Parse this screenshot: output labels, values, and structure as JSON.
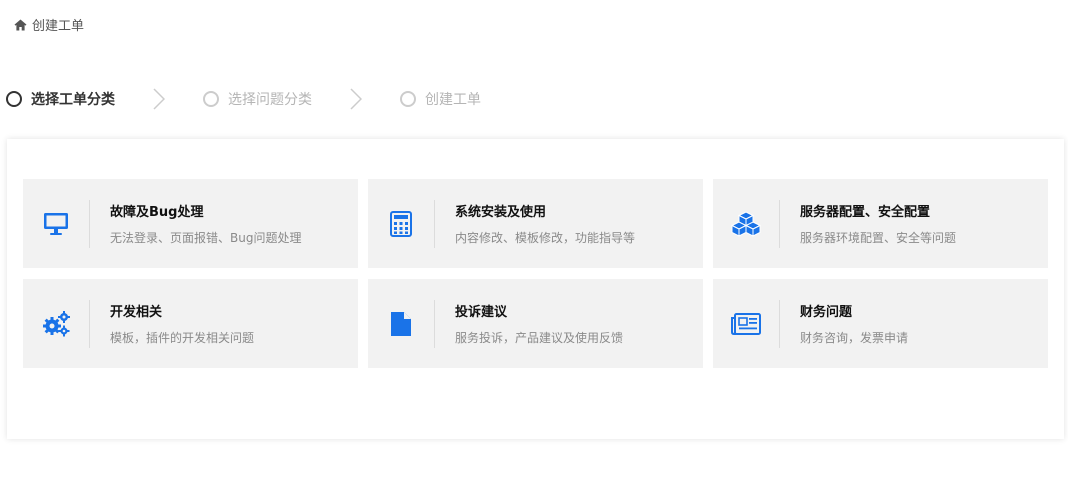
{
  "breadcrumb": {
    "icon": "home-icon",
    "label": "创建工单"
  },
  "steps": [
    {
      "label": "选择工单分类",
      "state": "active"
    },
    {
      "label": "选择问题分类",
      "state": "inactive"
    },
    {
      "label": "创建工单",
      "state": "inactive"
    }
  ],
  "categories": [
    {
      "icon": "monitor-icon",
      "title": "故障及Bug处理",
      "desc": "无法登录、页面报错、Bug问题处理"
    },
    {
      "icon": "calculator-icon",
      "title": "系统安装及使用",
      "desc": "内容修改、模板修改，功能指导等"
    },
    {
      "icon": "cubes-icon",
      "title": "服务器配置、安全配置",
      "desc": "服务器环境配置、安全等问题"
    },
    {
      "icon": "gears-icon",
      "title": "开发相关",
      "desc": "模板，插件的开发相关问题"
    },
    {
      "icon": "file-icon",
      "title": "投诉建议",
      "desc": "服务投诉，产品建议及使用反馈"
    },
    {
      "icon": "newspaper-icon",
      "title": "财务问题",
      "desc": "财务咨询，发票申请"
    }
  ],
  "colors": {
    "accent": "#1a73e8",
    "card_bg": "#f2f2f2",
    "inactive": "#b5b5b5"
  }
}
